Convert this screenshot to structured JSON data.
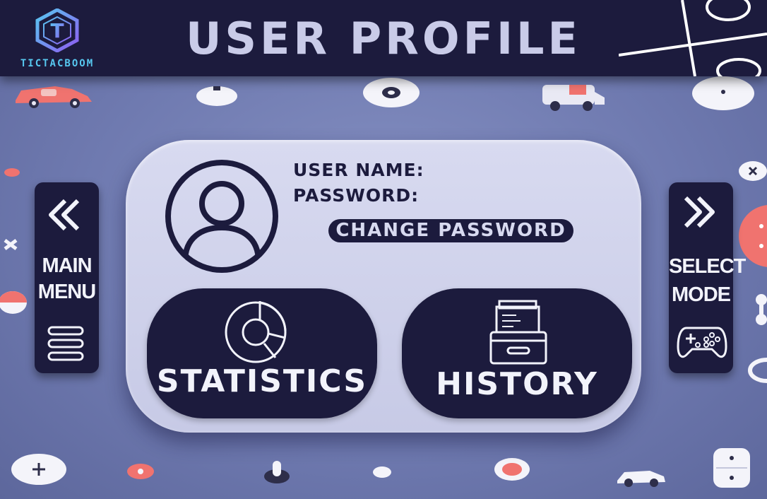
{
  "header": {
    "logo_letter": "T",
    "logo_text": "TICTACBOOM",
    "title": "USER PROFILE"
  },
  "profile": {
    "user_name_label": "USER NAME:",
    "password_label": "PASSWORD:",
    "change_password_label": "CHANGE PASSWORD"
  },
  "actions": {
    "statistics_label": "STATISTICS",
    "history_label": "HISTORY"
  },
  "nav": {
    "main_menu_line1": "MAIN",
    "main_menu_line2": "MENU",
    "select_mode_line1": "SELECT",
    "select_mode_line2": "MODE"
  },
  "icons": {
    "logo": "tictacboom-logo-icon",
    "avatar": "user-avatar-icon",
    "statistics": "pie-chart-icon",
    "history": "archive-box-icon",
    "back": "double-chevron-left-icon",
    "menu": "hamburger-menu-icon",
    "forward": "double-chevron-right-icon",
    "gamepad": "gamepad-icon"
  },
  "colors": {
    "navy": "#1c1b3d",
    "card": "#d8daf0",
    "background": "#7480b6",
    "logo_cyan": "#57c8f0",
    "logo_purple": "#8e5cf0",
    "title_text": "#c9cbe8",
    "accent_coral": "#f0736f"
  }
}
